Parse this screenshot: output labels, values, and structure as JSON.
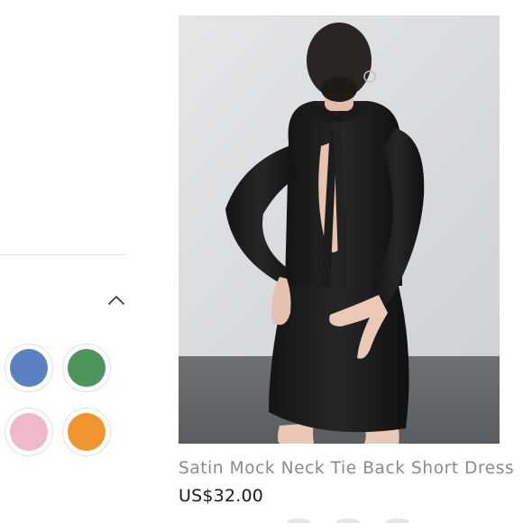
{
  "filters": {
    "toggle_icon": "chevron-up-icon",
    "color_swatches": [
      {
        "name": "blue",
        "color": "#5b80c4"
      },
      {
        "name": "green",
        "color": "#4c9459"
      },
      {
        "name": "pink",
        "color": "#efb8cb"
      },
      {
        "name": "orange",
        "color": "#f09630"
      }
    ]
  },
  "product": {
    "title": "Satin Mock Neck Tie Back Short Dress",
    "price": "US$32.00",
    "image_icon": "product-photo"
  }
}
